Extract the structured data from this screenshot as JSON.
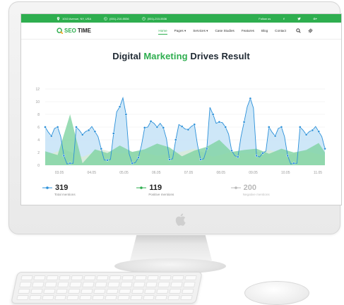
{
  "topbar": {
    "address": "1010 Avenue, NY, USA",
    "phone_1": "(001)-210-5536",
    "phone_2": "(001)-210-5536",
    "follow_label": "Follow us",
    "social_icons": [
      "facebook-icon",
      "twitter-icon",
      "google-plus-icon"
    ]
  },
  "nav": {
    "brand_part1": "SEO",
    "brand_part2": "TIME",
    "items": [
      {
        "label": "Home",
        "active": true
      },
      {
        "label": "Pages ▾",
        "active": false
      },
      {
        "label": "Services ▾",
        "active": false
      },
      {
        "label": "Case Studies",
        "active": false
      },
      {
        "label": "Features",
        "active": false
      },
      {
        "label": "Blog",
        "active": false
      },
      {
        "label": "Contact",
        "active": false
      }
    ]
  },
  "hero": {
    "title_part1": "Digital ",
    "title_accent": "Marketing",
    "title_part2": " Drives Result"
  },
  "colors": {
    "accent": "#2eae4f",
    "series_total": "#2b90d9",
    "series_positive": "#2eae4f",
    "series_negative": "#b9b9b9"
  },
  "chart_data": {
    "type": "area",
    "title": "",
    "xlabel": "",
    "ylabel": "",
    "ylim": [
      0,
      12
    ],
    "yticks": [
      0,
      2,
      4,
      6,
      8,
      10,
      12
    ],
    "xticks": [
      "03.05",
      "04.05",
      "05.05",
      "06.05",
      "07.05",
      "08.05",
      "09.05",
      "10.05",
      "11.05"
    ],
    "grid": true,
    "series": [
      {
        "name": "Total mentions",
        "style": "line-with-markers",
        "color": "#2b90d9",
        "fill": "#c9e4f7",
        "x": [
          0,
          0.5,
          1,
          1.5,
          2,
          2.5,
          3,
          3.5,
          4,
          4.5,
          5,
          5.5,
          6,
          6.5,
          7,
          7.5,
          8,
          8.5,
          9,
          9.5,
          10,
          10.5,
          11,
          11.5,
          12,
          12.5,
          13,
          13.5,
          14,
          14.5,
          15,
          15.5,
          16,
          16.5,
          17,
          17.5,
          18,
          18.5,
          19,
          19.5,
          20,
          20.5,
          21,
          21.5,
          22,
          22.5,
          23,
          23.5,
          24,
          24.5,
          25,
          25.5,
          26,
          26.5,
          27,
          27.5,
          28,
          28.5,
          29,
          29.5,
          30,
          30.5,
          31,
          31.5,
          32,
          32.5,
          33,
          33.5,
          34,
          34.5,
          35,
          35.5,
          36,
          36.5,
          37,
          37.5,
          38,
          38.5,
          39,
          39.5,
          40,
          40.5,
          41,
          41.5,
          42,
          42.5,
          43,
          43.5,
          44,
          44.5,
          45
        ],
        "values": [
          6,
          5.2,
          4.6,
          5.8,
          6,
          4.5,
          1.5,
          0.2,
          0.3,
          0.3,
          6,
          5.5,
          4.8,
          5.3,
          5.5,
          6.1,
          5.3,
          4.5,
          2.6,
          0.8,
          0.8,
          0.9,
          5,
          8.4,
          9.2,
          10.6,
          8,
          1.8,
          0.3,
          0.4,
          1.2,
          3.2,
          5.9,
          6,
          6.9,
          6.6,
          6,
          6.6,
          5.9,
          4.2,
          0.9,
          1,
          4,
          6.4,
          6.1,
          5.7,
          5.6,
          6.1,
          6.4,
          3.2,
          0.9,
          1,
          2.6,
          9.1,
          8,
          6.6,
          6.8,
          6.7,
          6,
          4.9,
          2.3,
          1.5,
          1.3,
          4.5,
          6.8,
          9.2,
          10.5,
          9,
          1.5,
          1.3,
          1.9,
          2.2,
          6,
          5.2,
          4.6,
          5.8,
          6,
          4.5,
          1.5,
          0.2,
          0.3,
          0.3,
          6,
          5.5,
          4.8,
          5.3,
          5.5,
          6.1,
          5.3,
          4.5,
          2.6
        ]
      },
      {
        "name": "Positive mentions",
        "style": "area",
        "color": "#2eae4f",
        "fill": "#7fd3a1",
        "x": [
          0,
          2,
          4,
          6,
          8,
          10,
          12,
          14,
          16,
          18,
          20,
          22,
          24,
          26,
          28,
          30,
          32,
          34,
          36,
          38,
          40,
          42,
          44,
          45
        ],
        "values": [
          2.2,
          1.6,
          8,
          0.3,
          2.5,
          1.9,
          3.1,
          2.1,
          2.5,
          3.4,
          2.8,
          1.4,
          2.3,
          2.9,
          4,
          2.1,
          2.4,
          2.6,
          1.8,
          2.6,
          2,
          2.4,
          3.5,
          2
        ]
      },
      {
        "name": "Negative mentions",
        "style": "area",
        "color": "#b9b9b9",
        "fill": "#d9ead8",
        "x": [
          0,
          3,
          6,
          9,
          12,
          15,
          18,
          21,
          24,
          27,
          30,
          33,
          36,
          39,
          42,
          45
        ],
        "values": [
          1.5,
          2.5,
          1.3,
          2.5,
          1.8,
          2.2,
          1.5,
          1.9,
          2.6,
          1.3,
          2.1,
          1.8,
          2.4,
          1.6,
          2.2,
          1.5
        ]
      }
    ]
  },
  "stats": [
    {
      "value": "319",
      "label": "Total mentions",
      "color": "#2b90d9"
    },
    {
      "value": "119",
      "label": "Positive mentions",
      "color": "#2eae4f"
    },
    {
      "value": "200",
      "label": "Negative mentions",
      "color": "#b9b9b9"
    }
  ]
}
